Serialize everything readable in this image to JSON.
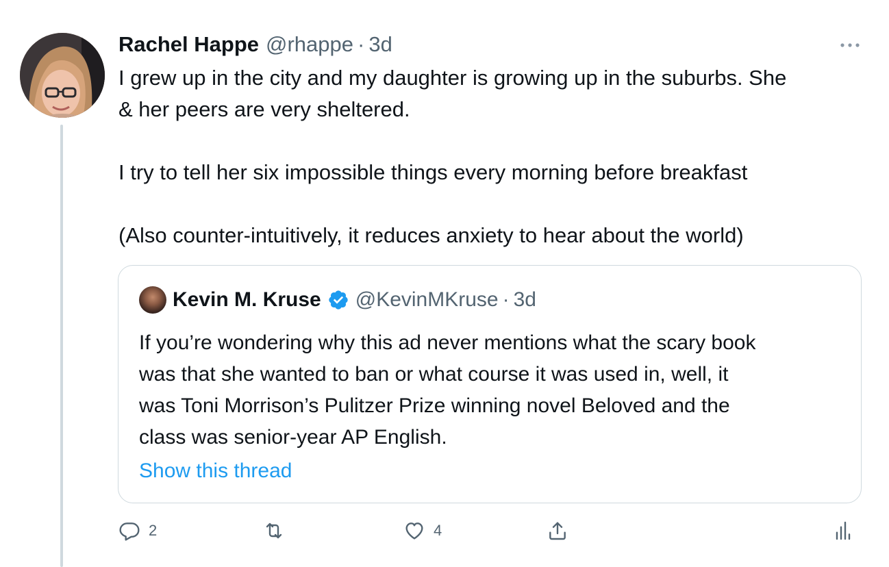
{
  "tweet": {
    "author_name": "Rachel Happe",
    "author_handle": "@rhappe",
    "separator": "·",
    "time": "3d",
    "text": [
      "I grew up in the city and my daughter is growing up in the suburbs. She",
      "& her peers are very sheltered.",
      "",
      "I try to tell her six impossible things every morning before breakfast",
      "",
      "(Also counter-intuitively, it reduces anxiety to hear about the world)"
    ],
    "more_icon": "more-horizontal-icon"
  },
  "quoted": {
    "author_name": "Kevin M. Kruse",
    "author_handle": "@KevinMKruse",
    "separator": "·",
    "time": "3d",
    "verified_icon": "verified-badge-icon",
    "text": [
      "If you’re wondering why this ad never mentions what the scary book",
      "was that she wanted to ban or what course it was used in, well, it",
      "was Toni Morrison’s Pulitzer Prize winning novel Beloved and the",
      "class was senior-year AP English."
    ],
    "show_thread": "Show this thread"
  },
  "actions": {
    "reply_count": "2",
    "like_count": "4"
  },
  "colors": {
    "accent": "#1d9bf0",
    "secondary_text": "#536471",
    "border": "#cfd9de"
  }
}
